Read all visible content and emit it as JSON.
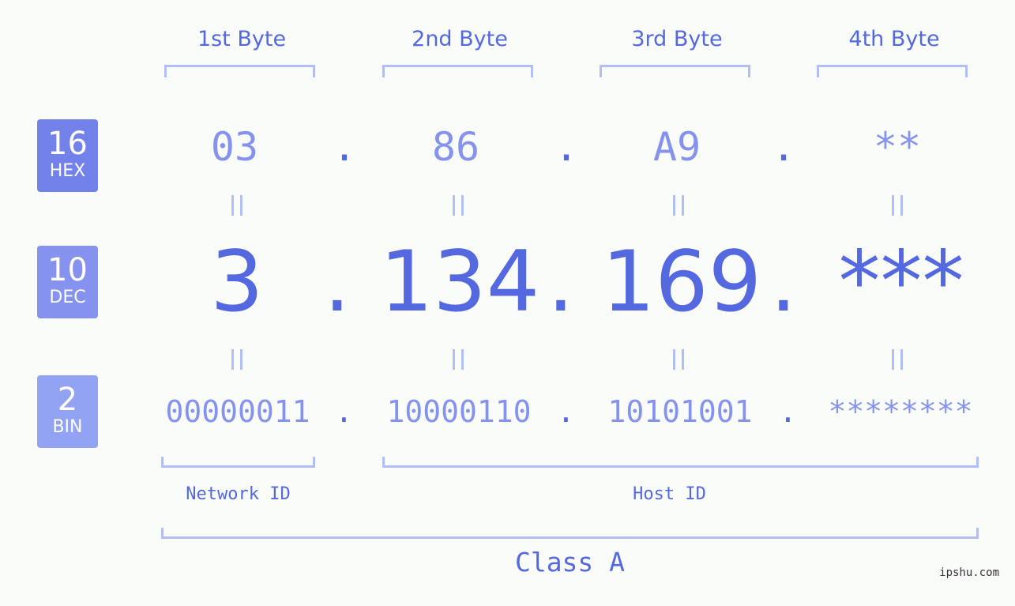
{
  "byte_headers": [
    "1st Byte",
    "2nd Byte",
    "3rd Byte",
    "4th Byte"
  ],
  "badges": {
    "hex": {
      "number": "16",
      "label": "HEX"
    },
    "dec": {
      "number": "10",
      "label": "DEC"
    },
    "bin": {
      "number": "2",
      "label": "BIN"
    }
  },
  "hex_values": [
    "03",
    "86",
    "A9",
    "**"
  ],
  "dec_values": [
    "3",
    "134",
    "169",
    "***"
  ],
  "bin_values": [
    "00000011",
    "10000110",
    "10101001",
    "********"
  ],
  "separator": ".",
  "network_id_label": "Network ID",
  "host_id_label": "Host ID",
  "class_label": "Class A",
  "watermark": "ipshu.com",
  "colors": {
    "primary": "#5468e0",
    "hex_badge": "#7282ea",
    "dec_badge": "#8593ee",
    "bin_badge": "#93a3f3",
    "bracket": "#b3bdf6",
    "background": "#fafcfa"
  }
}
